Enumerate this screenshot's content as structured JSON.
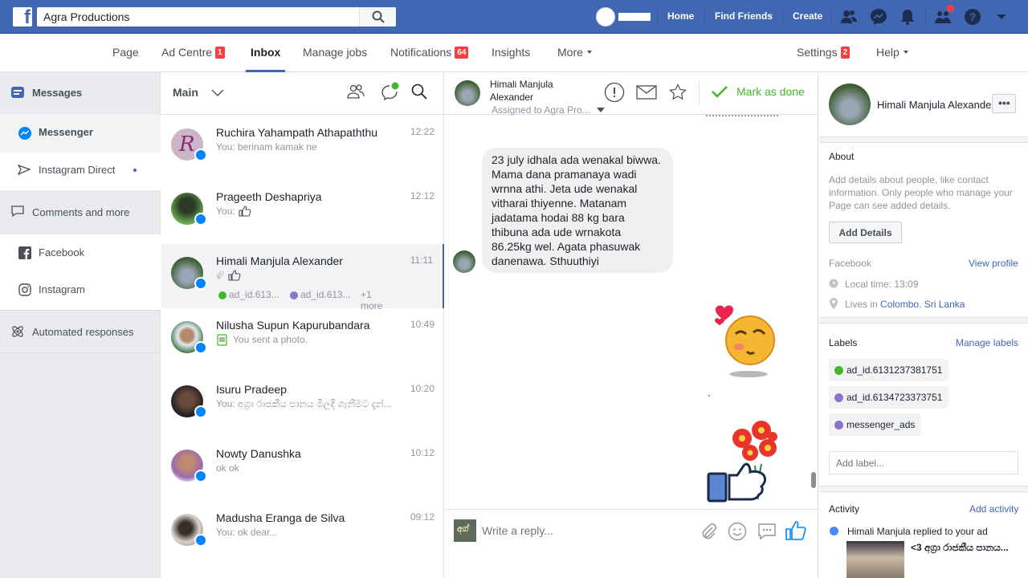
{
  "topbar": {
    "search_value": "Agra Productions",
    "nav": [
      "Home",
      "Find Friends",
      "Create"
    ]
  },
  "tabs": [
    {
      "label": "Page"
    },
    {
      "label": "Ad Centre",
      "badge": "1"
    },
    {
      "label": "Inbox"
    },
    {
      "label": "Manage jobs"
    },
    {
      "label": "Notifications",
      "badge": "64"
    },
    {
      "label": "Insights"
    },
    {
      "label": "More"
    }
  ],
  "tabs_right": [
    {
      "label": "Settings",
      "badge": "2"
    },
    {
      "label": "Help"
    }
  ],
  "leftnav": {
    "messages": "Messages",
    "messenger": "Messenger",
    "instagram_direct": "Instagram Direct",
    "comments": "Comments and more",
    "facebook": "Facebook",
    "instagram": "Instagram",
    "automated": "Automated responses"
  },
  "convlist": {
    "filter": "Main",
    "conversations": [
      {
        "name": "Ruchira Yahampath Athapaththu",
        "time": "12:22",
        "snippet": "You: berinam kamak ne",
        "avatar_color": "#b9a4b5"
      },
      {
        "name": "Prageeth Deshapriya",
        "time": "12:12",
        "snippet": "You:",
        "avatar_color": "#4d7a3c"
      },
      {
        "name": "Himali Manjula Alexander",
        "time": "11:11",
        "snippet": "",
        "avatar_color": "#6f8a6b"
      },
      {
        "name": "Nilusha Supun Kapurubandara",
        "time": "10:49",
        "snippet": "You sent a photo.",
        "avatar_color": "#3c6d3a"
      },
      {
        "name": "Isuru Pradeep",
        "time": "10:20",
        "snippet": "You: අග්‍රා රාජකීය පානය මිලදී ගැනීමට දැන්...",
        "avatar_color": "#2d2a33"
      },
      {
        "name": "Nowty Danushka",
        "time": "10:12",
        "snippet": "ok ok",
        "avatar_color": "#8a5a9a"
      },
      {
        "name": "Madusha Eranga de Silva",
        "time": "09:12",
        "snippet": "You: ok dear...",
        "avatar_color": "#7a6a5a"
      }
    ],
    "selected_tags": [
      {
        "label": "ad_id.613...",
        "color": "#42b72a"
      },
      {
        "label": "ad_id.613...",
        "color": "#8c72cb"
      },
      {
        "label": "+1 more"
      }
    ]
  },
  "chat": {
    "name_line1": "Himali Manjula",
    "name_line2": "Alexander",
    "assigned": "Assigned to Agra Pro...",
    "mark_done": "Mark as done",
    "message": "23 july  idhala ada wenakal biwwa. Mama dana pramanaya wadi wrnna athi. Jeta ude wenakal vitharai thiyenne. Matanam jadatama hodai 88 kg bara thibuna ada ude wrnakota 86.25kg wel. Agata phasuwak danenawa. Sthuuthiyi",
    "reply_placeholder": "Write a reply..."
  },
  "info": {
    "name": "Himali Manjula Alexander",
    "about_title": "About",
    "about_text": "Add details about people, like contact information. Only people who manage your Page can see added details.",
    "add_details": "Add Details",
    "facebook_label": "Facebook",
    "view_profile": "View profile",
    "local_time": "Local time: 13:09",
    "lives_in_prefix": "Lives in ",
    "lives_in_city": "Colombo",
    "lives_in_country": "Sri Lanka",
    "labels_title": "Labels",
    "manage_labels": "Manage labels",
    "labels": [
      {
        "label": "ad_id.6131237381751",
        "color": "#42b72a"
      },
      {
        "label": "ad_id.6134723373751",
        "color": "#8c72cb"
      },
      {
        "label": "messenger_ads",
        "color": "#8c72cb"
      }
    ],
    "add_label_placeholder": "Add label...",
    "activity_title": "Activity",
    "add_activity": "Add activity",
    "activity_text": "Himali Manjula replied to your ad",
    "activity_ad_text": "<3 අග්‍රා රාජකීය පානය..."
  },
  "colors": {
    "brand": "#4267b2",
    "badge": "#fa3e3e",
    "messenger": "#0084ff",
    "done": "#42b72a"
  }
}
